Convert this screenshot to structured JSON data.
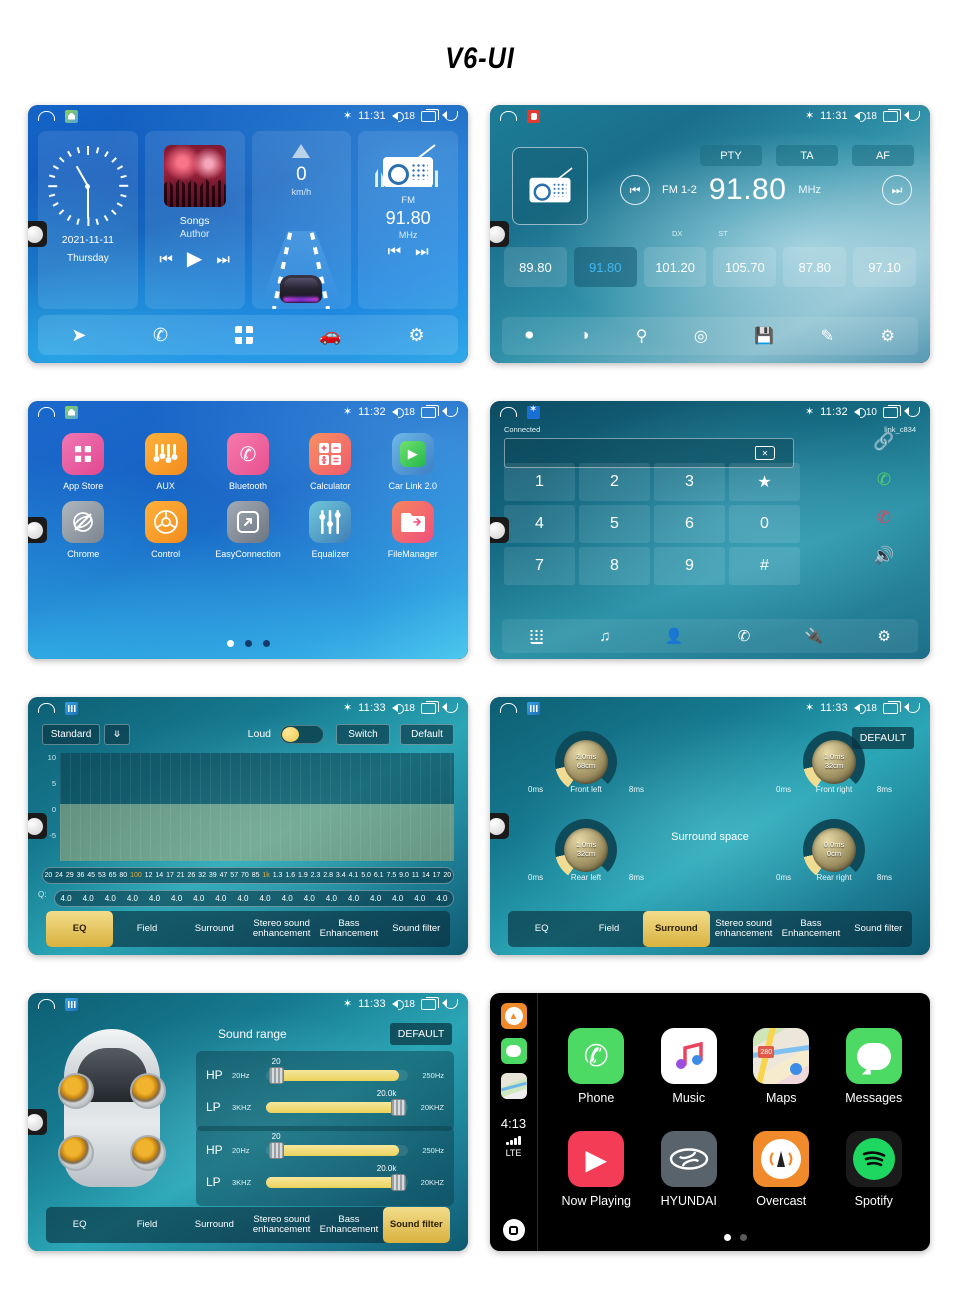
{
  "page": {
    "title": "V6-UI"
  },
  "screens": {
    "home": {
      "status": {
        "time": "11:31",
        "volume": "18",
        "bluetooth_icon": "bluetooth-icon",
        "volume_icon": "volume-icon",
        "recents_icon": "recents-icon",
        "back_icon": "back-icon",
        "home_icon": "home-icon",
        "app_icon": "launcher-icon"
      },
      "clock": {
        "date": "2021-11-11",
        "weekday": "Thursday"
      },
      "music": {
        "title": "Songs",
        "artist": "Author",
        "prev": "⏮",
        "play": "▶",
        "next": "⏭"
      },
      "speed": {
        "value": "0",
        "unit": "km/h"
      },
      "radio": {
        "band": "FM",
        "freq": "91.80",
        "unit": "MHz",
        "prev": "⏮",
        "next": "⏭"
      },
      "dock": [
        "navigation-icon",
        "phone-icon",
        "apps-icon",
        "carlink-icon",
        "settings-icon"
      ]
    },
    "radio": {
      "status": {
        "time": "11:31",
        "volume": "18"
      },
      "rds": [
        "PTY",
        "TA",
        "AF"
      ],
      "band_label": "FM 1-2",
      "freq": "91.80",
      "unit": "MHz",
      "dx": "DX",
      "st": "ST",
      "presets": [
        "89.80",
        "91.80",
        "101.20",
        "105.70",
        "87.80",
        "97.10"
      ],
      "active_preset_index": 1,
      "dock": [
        "band-icon",
        "contrast-icon",
        "search-icon",
        "scan-icon",
        "save-icon",
        "edit-icon",
        "settings-icon"
      ]
    },
    "apps": {
      "status": {
        "time": "11:32",
        "volume": "18"
      },
      "items": [
        {
          "label": "App Store",
          "icon": "app-store-icon",
          "color": "#e8559d"
        },
        {
          "label": "AUX",
          "icon": "aux-icon",
          "color": "#f5a623"
        },
        {
          "label": "Bluetooth",
          "icon": "bluetooth-phone-icon",
          "color": "#ee5b9b"
        },
        {
          "label": "Calculator",
          "icon": "calculator-icon",
          "color": "#f2604f"
        },
        {
          "label": "Car Link 2.0",
          "icon": "car-link-icon",
          "color": "#4e9ad6"
        },
        {
          "label": "Chrome",
          "icon": "chrome-icon",
          "color": "#9aa3ad"
        },
        {
          "label": "Control",
          "icon": "steering-wheel-icon",
          "color": "#f5a623"
        },
        {
          "label": "EasyConnection",
          "icon": "easyconnection-icon",
          "color": "#8d97a3"
        },
        {
          "label": "Equalizer",
          "icon": "equalizer-icon",
          "color": "#4aa8c9"
        },
        {
          "label": "FileManager",
          "icon": "file-manager-icon",
          "color": "#f2604f"
        }
      ],
      "page_dots": 3,
      "active_dot": 0
    },
    "bluetooth": {
      "status": {
        "time": "11:32",
        "volume": "10"
      },
      "connection_status": "Connected",
      "device_name": "link_c834",
      "input_value": "",
      "backspace_icon": "backspace-icon",
      "keys": [
        "1",
        "2",
        "3",
        "★",
        "4",
        "5",
        "6",
        "0",
        "7",
        "8",
        "9",
        "#"
      ],
      "side_buttons": [
        "link-icon",
        "call-icon",
        "end-call-icon",
        "speaker-icon"
      ],
      "dock": [
        "dialpad-icon",
        "music-icon",
        "contacts-icon",
        "call-log-icon",
        "pair-icon",
        "settings-icon"
      ]
    },
    "eq": {
      "status": {
        "time": "11:33",
        "volume": "18"
      },
      "preset": "Standard",
      "chevron": "❯",
      "loud_label": "Loud",
      "loud_on": true,
      "switch_label": "Switch",
      "default_label": "Default",
      "y_ticks": [
        "10",
        "5",
        "0",
        "-5"
      ],
      "frequencies": [
        "20",
        "24",
        "29",
        "36",
        "45",
        "53",
        "65",
        "80",
        "100",
        "12",
        "14",
        "17",
        "21",
        "26",
        "32",
        "39",
        "47",
        "57",
        "70",
        "85",
        "1k",
        "1.3",
        "1.6",
        "1.9",
        "2.3",
        "2.8",
        "3.4",
        "4.1",
        "5.0",
        "6.1",
        "7.5",
        "9.0",
        "11",
        "14",
        "17",
        "20"
      ],
      "highlight_freqs": [
        "100",
        "1k"
      ],
      "q_label": "Q:",
      "q_values": [
        "4.0",
        "4.0",
        "4.0",
        "4.0",
        "4.0",
        "4.0",
        "4.0",
        "4.0",
        "4.0",
        "4.0",
        "4.0",
        "4.0",
        "4.0",
        "4.0",
        "4.0",
        "4.0",
        "4.0",
        "4.0"
      ],
      "tabs": [
        "EQ",
        "Field",
        "Surround",
        "Stereo sound enhancement",
        "Bass Enhancement",
        "Sound filter"
      ],
      "active_tab": 0
    },
    "surround": {
      "status": {
        "time": "11:33",
        "volume": "18"
      },
      "default_label": "DEFAULT",
      "title": "Surround space",
      "knobs": [
        {
          "name": "Front left",
          "delay": "2.0ms",
          "distance": "68cm",
          "min": "0ms",
          "max": "8ms"
        },
        {
          "name": "Front right",
          "delay": "1.0ms",
          "distance": "32cm",
          "min": "0ms",
          "max": "8ms"
        },
        {
          "name": "Rear left",
          "delay": "1.0ms",
          "distance": "32cm",
          "min": "0ms",
          "max": "8ms"
        },
        {
          "name": "Rear right",
          "delay": "0.0ms",
          "distance": "0cm",
          "min": "0ms",
          "max": "8ms"
        }
      ],
      "tabs": [
        "EQ",
        "Field",
        "Surround",
        "Stereo sound enhancement",
        "Bass Enhancement",
        "Sound filter"
      ],
      "active_tab": 2
    },
    "soundfilter": {
      "status": {
        "time": "11:33",
        "volume": "18"
      },
      "title": "Sound range",
      "default_label": "DEFAULT",
      "groups": [
        {
          "rows": [
            {
              "tag": "HP",
              "min": "20Hz",
              "max": "250Hz",
              "value": "20",
              "fill_pct": 88,
              "thumb_pct": 2
            },
            {
              "tag": "LP",
              "min": "3KHZ",
              "max": "20KHZ",
              "value": "20.0k",
              "fill_pct": 92,
              "thumb_pct": 88
            }
          ]
        },
        {
          "rows": [
            {
              "tag": "HP",
              "min": "20Hz",
              "max": "250Hz",
              "value": "20",
              "fill_pct": 88,
              "thumb_pct": 2
            },
            {
              "tag": "LP",
              "min": "3KHZ",
              "max": "20KHZ",
              "value": "20.0k",
              "fill_pct": 92,
              "thumb_pct": 88
            }
          ]
        }
      ],
      "tabs": [
        "EQ",
        "Field",
        "Surround",
        "Stereo sound enhancement",
        "Bass Enhancement",
        "Sound filter"
      ],
      "active_tab": 5
    },
    "carplay": {
      "sidebar": {
        "icons": [
          "overcast-icon",
          "messages-icon",
          "maps-icon"
        ],
        "time": "4:13",
        "network": "LTE",
        "home_icon": "carplay-home-icon"
      },
      "apps": [
        {
          "label": "Phone",
          "icon": "phone-icon"
        },
        {
          "label": "Music",
          "icon": "music-icon"
        },
        {
          "label": "Maps",
          "icon": "maps-icon"
        },
        {
          "label": "Messages",
          "icon": "messages-icon"
        },
        {
          "label": "Now Playing",
          "icon": "now-playing-icon"
        },
        {
          "label": "HYUNDAI",
          "icon": "hyundai-icon"
        },
        {
          "label": "Overcast",
          "icon": "overcast-icon"
        },
        {
          "label": "Spotify",
          "icon": "spotify-icon"
        }
      ],
      "page_dots": 2,
      "active_dot": 0,
      "maps_shield": "280"
    }
  }
}
